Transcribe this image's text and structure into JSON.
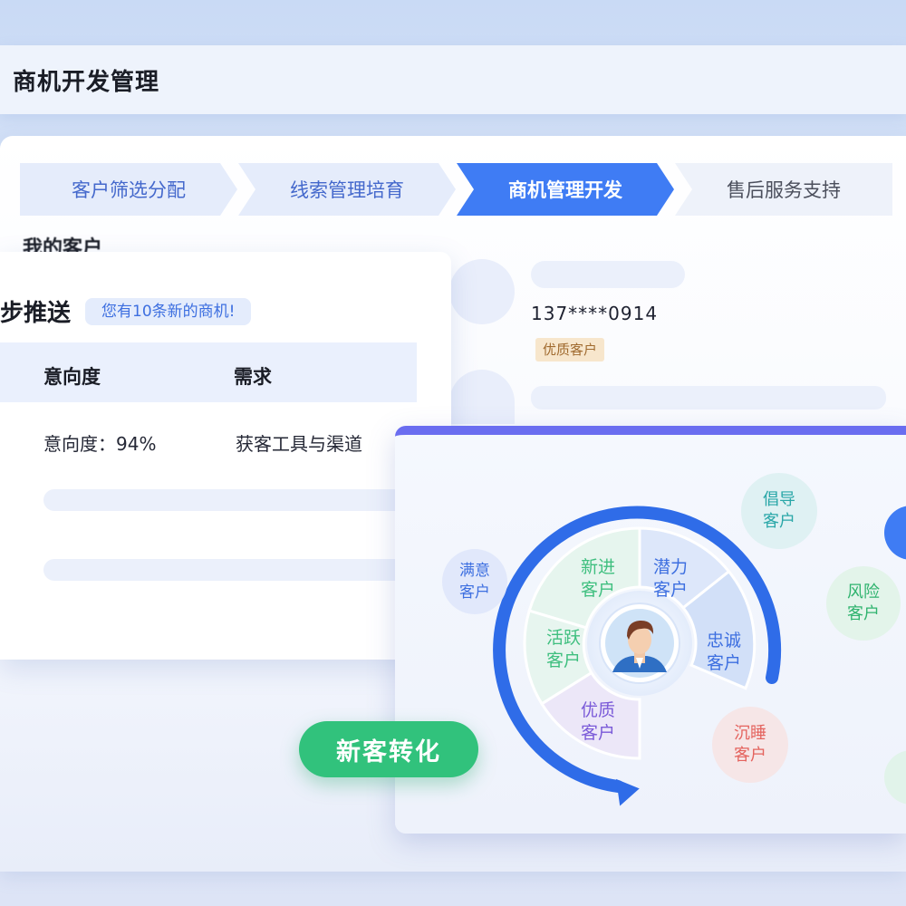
{
  "header": {
    "title": "商机开发管理"
  },
  "steps": [
    {
      "label": "客户筛选分配",
      "state": "done"
    },
    {
      "label": "线索管理培育",
      "state": "done"
    },
    {
      "label": "商机管理开发",
      "state": "active"
    },
    {
      "label": "售后服务支持",
      "state": "pending"
    }
  ],
  "my_customers": {
    "title": "我的客户"
  },
  "push_panel": {
    "title": "步推送",
    "badge": "您有10条新的商机!",
    "columns": [
      "意向度",
      "需求"
    ],
    "row": {
      "intent": "意向度：94%",
      "need": "获客工具与渠道"
    }
  },
  "customer_card": {
    "phone": "137****0914",
    "tag": "优质客户"
  },
  "ring": {
    "segments": [
      {
        "label": "新进客户",
        "color": "#3fbf7f"
      },
      {
        "label": "潜力客户",
        "color": "#3d6fe0"
      },
      {
        "label": "忠诚客户",
        "color": "#3d6fe0"
      },
      {
        "label": "优质客户",
        "color": "#7a5ad8"
      },
      {
        "label": "活跃客户",
        "color": "#3fbf7f"
      }
    ],
    "outer": [
      {
        "label": "满意客户",
        "color": "#3d6fe0"
      },
      {
        "label": "倡导客户",
        "color": "#2aa7a8"
      },
      {
        "label": "风险客户",
        "color": "#2fb36e"
      },
      {
        "label": "沉睡客户",
        "color": "#e4635e"
      }
    ],
    "avatar_icon": "user-avatar-icon"
  },
  "convert_button": {
    "label": "新客转化"
  },
  "colors": {
    "accent": "#3f7cf4",
    "green": "#31c27c",
    "purple_bar": "#6a6df0"
  }
}
